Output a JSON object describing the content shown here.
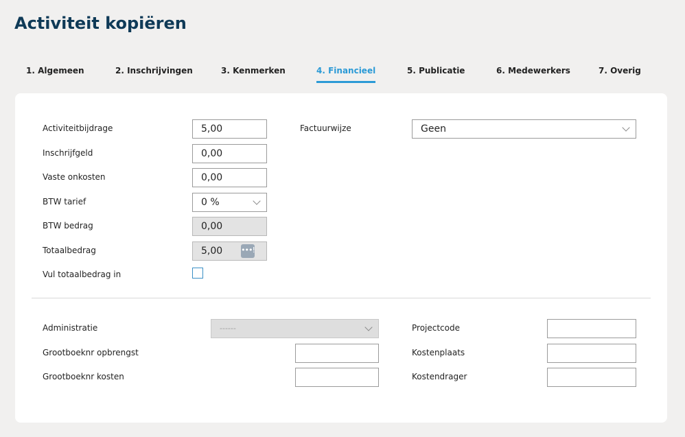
{
  "page": {
    "title": "Activiteit kopiëren"
  },
  "tabs": [
    {
      "label": "1. Algemeen"
    },
    {
      "label": "2. Inschrijvingen"
    },
    {
      "label": "3. Kenmerken"
    },
    {
      "label": "4. Financieel",
      "active": true
    },
    {
      "label": "5. Publicatie"
    },
    {
      "label": "6. Medewerkers"
    },
    {
      "label": "7. Overig"
    }
  ],
  "financial": {
    "activiteitbijdrage": {
      "label": "Activiteitbijdrage",
      "value": "5,00"
    },
    "inschrijfgeld": {
      "label": "Inschrijfgeld",
      "value": "0,00"
    },
    "vaste_onkosten": {
      "label": "Vaste onkosten",
      "value": "0,00"
    },
    "btw_tarief": {
      "label": "BTW tarief",
      "value": "0 %"
    },
    "btw_bedrag": {
      "label": "BTW bedrag",
      "value": "0,00"
    },
    "totaalbedrag": {
      "label": "Totaalbedrag",
      "value": "5,00",
      "button": "•••!"
    },
    "vul_totaalbedrag": {
      "label": "Vul totaalbedrag in",
      "checked": false
    },
    "factuurwijze": {
      "label": "Factuurwijze",
      "value": "Geen"
    }
  },
  "accounting": {
    "administratie": {
      "label": "Administratie",
      "value": "------"
    },
    "grootboek_opbrengst": {
      "label": "Grootboeknr opbrengst",
      "value": ""
    },
    "grootboek_kosten": {
      "label": "Grootboeknr kosten",
      "value": ""
    },
    "projectcode": {
      "label": "Projectcode",
      "value": ""
    },
    "kostenplaats": {
      "label": "Kostenplaats",
      "value": ""
    },
    "kostendrager": {
      "label": "Kostendrager",
      "value": ""
    }
  },
  "colors": {
    "accent": "#2b9ad6",
    "title": "#0f3a57",
    "background": "#f1f0ef"
  },
  "icons": {
    "dropdown": "chevron-down-icon",
    "lookup": "ellipsis-icon"
  }
}
